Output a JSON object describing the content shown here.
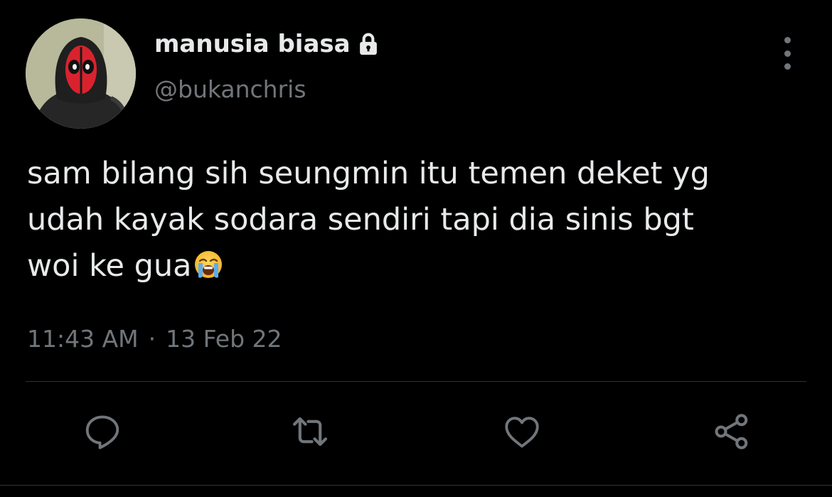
{
  "tweet": {
    "author": {
      "display_name": "manusia biasa",
      "handle": "@bukanchris",
      "protected_icon": "lock-icon"
    },
    "text": "sam bilang sih seungmin itu temen deket yg\nudah kayak sodara sendiri tapi dia sinis bgt\nwoi ke gua",
    "emoji": "loudly-crying-face-emoji",
    "time": "11:43 AM",
    "separator": "·",
    "date": "13 Feb 22"
  },
  "actions": [
    {
      "icon": "reply-icon"
    },
    {
      "icon": "retweet-icon"
    },
    {
      "icon": "like-icon"
    },
    {
      "icon": "share-icon"
    }
  ],
  "colors": {
    "background": "#000000",
    "primary_text": "#e7e9ea",
    "secondary_text": "#71767b",
    "divider": "#2f3336",
    "mask_red": "#d8232f"
  }
}
